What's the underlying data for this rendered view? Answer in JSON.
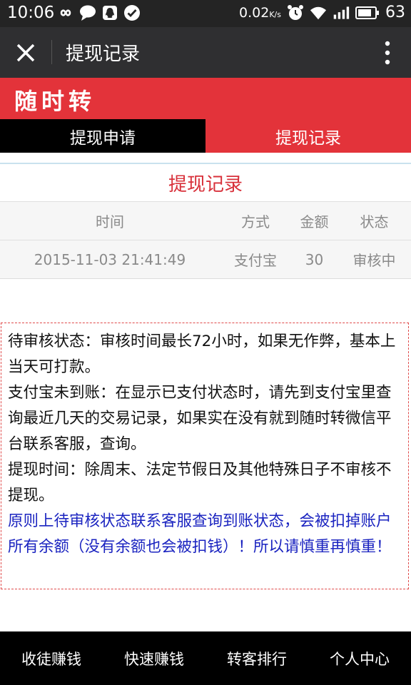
{
  "status_bar": {
    "time": "10:06",
    "network_speed": "0.02",
    "network_speed_unit": "K/s",
    "battery": "63",
    "icons": [
      "infinity-icon",
      "chat-bubble-icon",
      "qq-icon",
      "check-circle-icon",
      "alarm-clock-icon",
      "wifi-icon",
      "signal-icon",
      "battery-icon"
    ]
  },
  "title_bar": {
    "title": "提现记录"
  },
  "brand": {
    "logo_text": "随时转",
    "color": "#e3333a"
  },
  "tabs": [
    {
      "label": "提现申请",
      "active": false
    },
    {
      "label": "提现记录",
      "active": true
    }
  ],
  "records": {
    "title": "提现记录",
    "columns": [
      "时间",
      "方式",
      "金额",
      "状态"
    ],
    "rows": [
      {
        "time": "2015-11-03 21:41:49",
        "method": "支付宝",
        "amount": "30",
        "status": "审核中"
      }
    ]
  },
  "notice": {
    "paragraphs": [
      "待审核状态：审核时间最长72小时，如果无作弊，基本上当天可打款。",
      "支付宝未到账：在显示已支付状态时，请先到支付宝里查询最近几天的交易记录，如果实在没有就到随时转微信平台联系客服，查询。",
      "提现时间：除周末、法定节假日及其他特殊日子不审核不提现。"
    ],
    "warning": "原则上待审核状态联系客服查询到账状态，会被扣掉账户所有余额（没有余额也会被扣钱）！所以请慎重再慎重！",
    "warning_color": "#1a23c0"
  },
  "bottom_nav": [
    {
      "label": "收徒赚钱"
    },
    {
      "label": "快速赚钱"
    },
    {
      "label": "转客排行"
    },
    {
      "label": "个人中心"
    }
  ]
}
